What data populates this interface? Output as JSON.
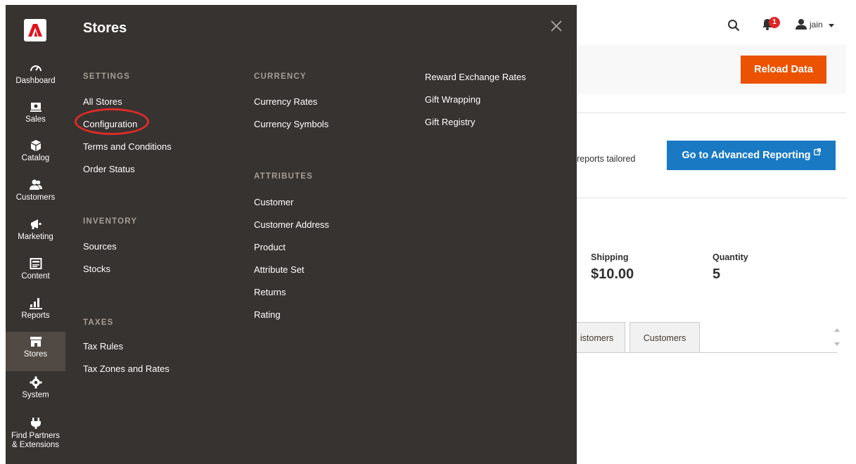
{
  "nav": {
    "items": [
      {
        "label": "Dashboard",
        "icon": "dashboard-icon"
      },
      {
        "label": "Sales",
        "icon": "sales-icon"
      },
      {
        "label": "Catalog",
        "icon": "catalog-icon"
      },
      {
        "label": "Customers",
        "icon": "customers-icon"
      },
      {
        "label": "Marketing",
        "icon": "marketing-icon"
      },
      {
        "label": "Content",
        "icon": "content-icon"
      },
      {
        "label": "Reports",
        "icon": "reports-icon"
      },
      {
        "label": "Stores",
        "icon": "stores-icon"
      },
      {
        "label": "System",
        "icon": "system-icon"
      },
      {
        "label": "Find Partners & Extensions",
        "icon": "partners-icon"
      }
    ],
    "active": "Stores"
  },
  "panel": {
    "title": "Stores",
    "settings": {
      "title": "SETTINGS",
      "links": [
        "All Stores",
        "Configuration",
        "Terms and Conditions",
        "Order Status"
      ]
    },
    "inventory": {
      "title": "INVENTORY",
      "links": [
        "Sources",
        "Stocks"
      ]
    },
    "taxes": {
      "title": "TAXES",
      "links": [
        "Tax Rules",
        "Tax Zones and Rates"
      ]
    },
    "currency": {
      "title": "CURRENCY",
      "links": [
        "Currency Rates",
        "Currency Symbols"
      ]
    },
    "attributes": {
      "title": "ATTRIBUTES",
      "links": [
        "Customer",
        "Customer Address",
        "Product",
        "Attribute Set",
        "Returns",
        "Rating"
      ]
    },
    "other": {
      "links": [
        "Reward Exchange Rates",
        "Gift Wrapping",
        "Gift Registry"
      ]
    }
  },
  "header": {
    "user": "jain",
    "notifications": "1"
  },
  "dashboard": {
    "reload_label": "Reload Data",
    "advanced_text": "reports tailored",
    "advanced_button": "Go to Advanced Reporting",
    "shipping_label": "Shipping",
    "shipping_value": "$10.00",
    "quantity_label": "Quantity",
    "quantity_value": "5",
    "tabs": [
      "istomers",
      "Customers"
    ]
  },
  "colors": {
    "nav_bg": "#373330",
    "accent_orange": "#eb5202",
    "accent_blue": "#1979c3",
    "highlight_red": "#e02b27"
  }
}
